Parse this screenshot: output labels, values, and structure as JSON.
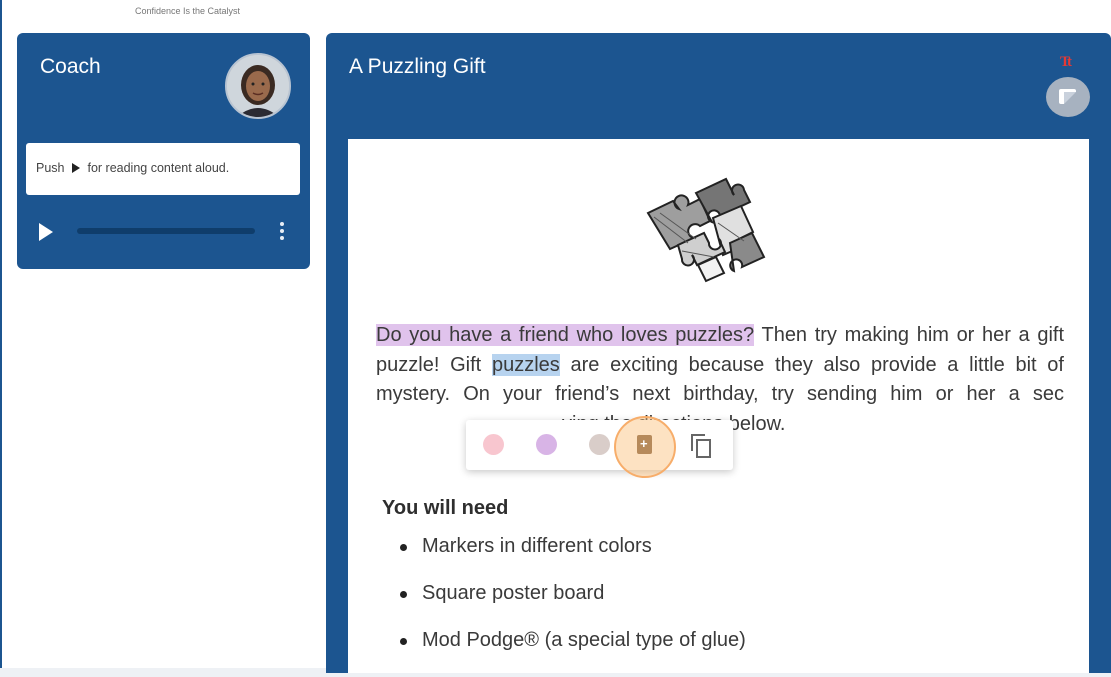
{
  "header": {
    "tagline": "Confidence Is the Catalyst"
  },
  "coach": {
    "title": "Coach",
    "instruction_before": "Push",
    "instruction_after": "for reading content aloud.",
    "audio_progress": 0.0
  },
  "lesson": {
    "title": "A Puzzling Gift",
    "text_size_icon": "Tt",
    "paragraph": {
      "highlight_1": "Do you have a friend who loves puzzles?",
      "part_2": " Then try making him or her a gift puzzle! Gift ",
      "highlight_2": "puzzles",
      "part_3": " are exciting because they also provide a little bit of mystery. On your friend’s next birthday, try sending him or her a sec",
      "part_4": "ving the directions below."
    },
    "needs_heading": "You will need",
    "needs_items": [
      "Markers in different colors",
      "Square poster board",
      "Mod Podge® (a special type of glue)"
    ]
  },
  "toolbar": {
    "swatches": [
      "#f8c6cf",
      "#d8b4e6",
      "#d9cdc9"
    ],
    "icons": [
      "add-note-icon",
      "copy-icon"
    ]
  },
  "colors": {
    "brand_blue": "#1c5590",
    "highlight_purple": "#e0c3ec",
    "highlight_blue": "#b7d3ef",
    "accent_orange": "#f7ad6a"
  }
}
